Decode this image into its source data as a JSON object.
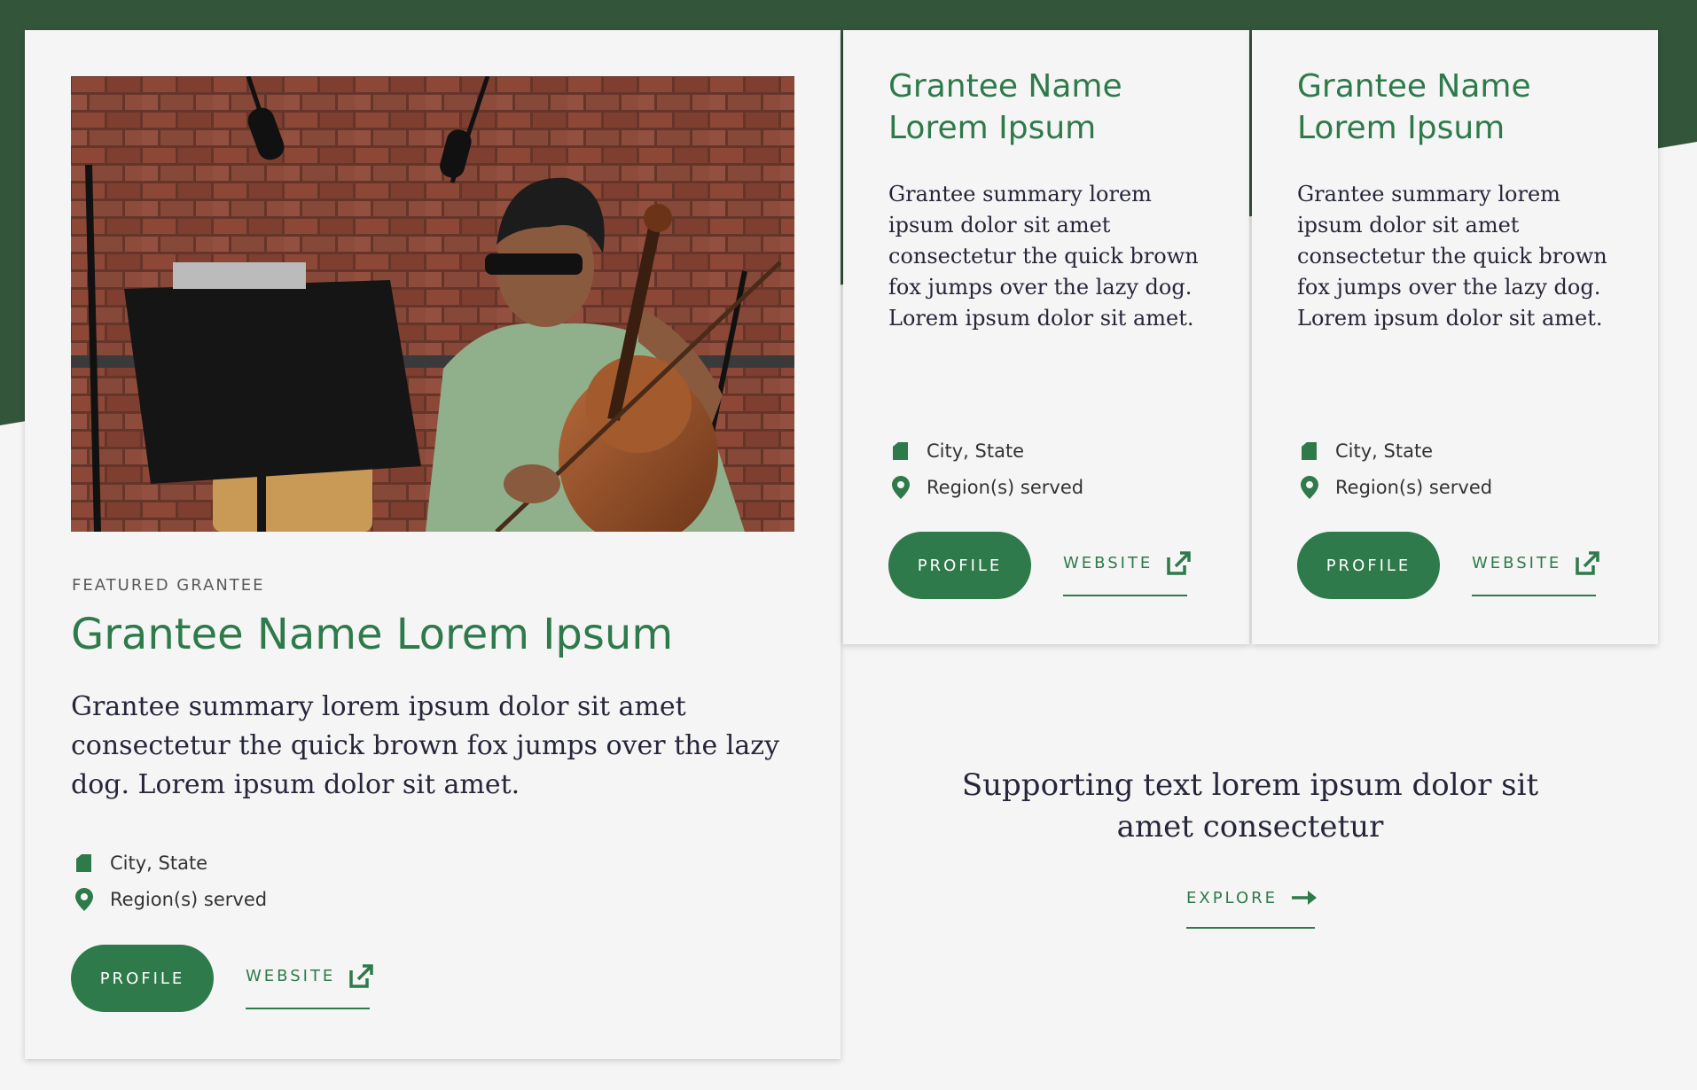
{
  "colors": {
    "brand_green": "#2e7a4b",
    "dark_green": "#33563a",
    "background": "#f5f5f5",
    "text_dark": "#26263a"
  },
  "featured": {
    "eyebrow": "FEATURED GRANTEE",
    "title": "Grantee Name Lorem Ipsum",
    "summary": "Grantee summary lorem ipsum dolor sit amet consectetur the quick brown fox jumps over the lazy dog. Lorem ipsum dolor sit amet.",
    "location": "City, State",
    "region": "Region(s) served",
    "profile_label": "PROFILE",
    "website_label": "WEBSITE"
  },
  "cards": [
    {
      "title": "Grantee Name Lorem Ipsum",
      "summary": "Grantee summary lorem ipsum dolor sit amet consectetur the quick brown fox jumps over the lazy dog. Lorem ipsum dolor sit amet.",
      "location": "City, State",
      "region": "Region(s) served",
      "profile_label": "PROFILE",
      "website_label": "WEBSITE"
    },
    {
      "title": "Grantee Name Lorem Ipsum",
      "summary": "Grantee summary lorem ipsum dolor sit amet consectetur the quick brown fox jumps over the lazy dog. Lorem ipsum dolor sit amet.",
      "location": "City, State",
      "region": "Region(s) served",
      "profile_label": "PROFILE",
      "website_label": "WEBSITE"
    }
  ],
  "support": {
    "text": "Supporting text lorem ipsum dolor sit amet consectetur",
    "explore_label": "EXPLORE"
  },
  "icons": {
    "location": "building-icon",
    "region": "map-pin-icon",
    "website": "external-link-icon",
    "explore": "arrow-right-icon"
  }
}
